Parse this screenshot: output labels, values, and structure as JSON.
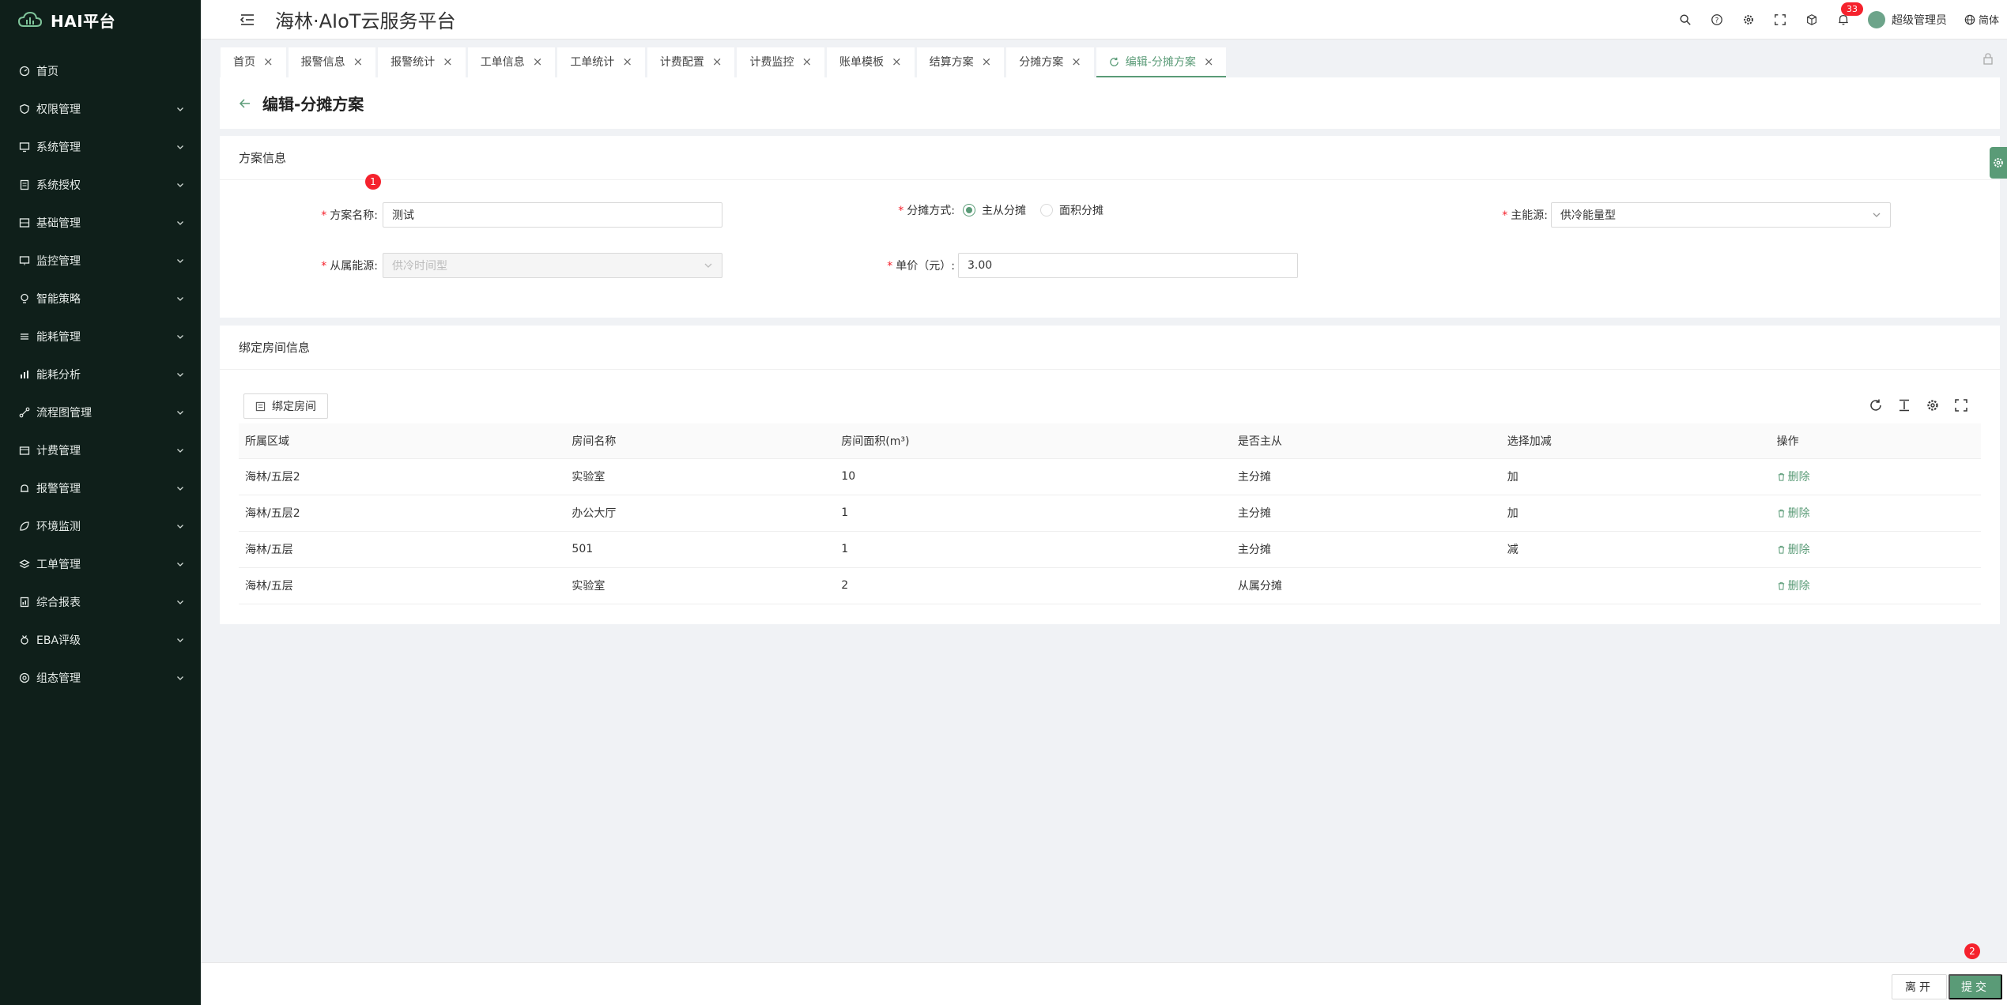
{
  "app": {
    "logo_text": "HAI平台",
    "title": "海林·AIoT云服务平台"
  },
  "sidebar": {
    "items": [
      {
        "label": "首页",
        "icon": "dashboard-icon",
        "has_arrow": false
      },
      {
        "label": "权限管理",
        "icon": "shield-icon",
        "has_arrow": true
      },
      {
        "label": "系统管理",
        "icon": "monitor-icon",
        "has_arrow": true
      },
      {
        "label": "系统授权",
        "icon": "document-icon",
        "has_arrow": true
      },
      {
        "label": "基础管理",
        "icon": "database-icon",
        "has_arrow": true
      },
      {
        "label": "监控管理",
        "icon": "screen-icon",
        "has_arrow": true
      },
      {
        "label": "智能策略",
        "icon": "bulb-icon",
        "has_arrow": true
      },
      {
        "label": "能耗管理",
        "icon": "sliders-icon",
        "has_arrow": true
      },
      {
        "label": "能耗分析",
        "icon": "bar-chart-icon",
        "has_arrow": true
      },
      {
        "label": "流程图管理",
        "icon": "flow-icon",
        "has_arrow": true
      },
      {
        "label": "计费管理",
        "icon": "wallet-icon",
        "has_arrow": true
      },
      {
        "label": "报警管理",
        "icon": "alarm-icon",
        "has_arrow": true
      },
      {
        "label": "环境监测",
        "icon": "leaf-icon",
        "has_arrow": true
      },
      {
        "label": "工单管理",
        "icon": "layers-icon",
        "has_arrow": true
      },
      {
        "label": "综合报表",
        "icon": "report-icon",
        "has_arrow": true
      },
      {
        "label": "EBA评级",
        "icon": "medal-icon",
        "has_arrow": true
      },
      {
        "label": "组态管理",
        "icon": "circle-gear-icon",
        "has_arrow": true
      }
    ]
  },
  "header": {
    "notification_count": "33",
    "user_name": "超级管理员",
    "language": "简体"
  },
  "tabs": [
    {
      "label": "首页",
      "active": false
    },
    {
      "label": "报警信息",
      "active": false
    },
    {
      "label": "报警统计",
      "active": false
    },
    {
      "label": "工单信息",
      "active": false
    },
    {
      "label": "工单统计",
      "active": false
    },
    {
      "label": "计费配置",
      "active": false
    },
    {
      "label": "计费监控",
      "active": false
    },
    {
      "label": "账单模板",
      "active": false
    },
    {
      "label": "结算方案",
      "active": false
    },
    {
      "label": "分摊方案",
      "active": false
    },
    {
      "label": "编辑-分摊方案",
      "active": true
    }
  ],
  "page": {
    "title": "编辑-分摊方案"
  },
  "scheme_info": {
    "section_title": "方案信息",
    "marker": "1",
    "name_label": "方案名称:",
    "name_value": "测试",
    "method_label": "分摊方式:",
    "method_options": [
      "主从分摊",
      "面积分摊"
    ],
    "method_selected": "主从分摊",
    "main_energy_label": "主能源:",
    "main_energy_value": "供冷能量型",
    "sub_energy_label": "从属能源:",
    "sub_energy_value": "供冷时间型",
    "unit_price_label": "单价（元）:",
    "unit_price_value": "3.00"
  },
  "bind_info": {
    "section_title": "绑定房间信息",
    "bind_button": "绑定房间",
    "columns": [
      "所属区域",
      "房间名称",
      "房间面积(m³)",
      "是否主从",
      "选择加减",
      "操作"
    ],
    "rows": [
      [
        "海林/五层2",
        "实验室",
        "10",
        "主分摊",
        "加",
        "删除"
      ],
      [
        "海林/五层2",
        "办公大厅",
        "1",
        "主分摊",
        "加",
        "删除"
      ],
      [
        "海林/五层",
        "501",
        "1",
        "主分摊",
        "减",
        "删除"
      ],
      [
        "海林/五层",
        "实验室",
        "2",
        "从属分摊",
        "",
        "删除"
      ]
    ]
  },
  "footer": {
    "leave_label": "离开",
    "submit_label": "提交",
    "marker": "2"
  },
  "colors": {
    "sidebar_bg": "#0f1f1a",
    "accent": "#5a9b77",
    "danger": "#f5222d"
  }
}
